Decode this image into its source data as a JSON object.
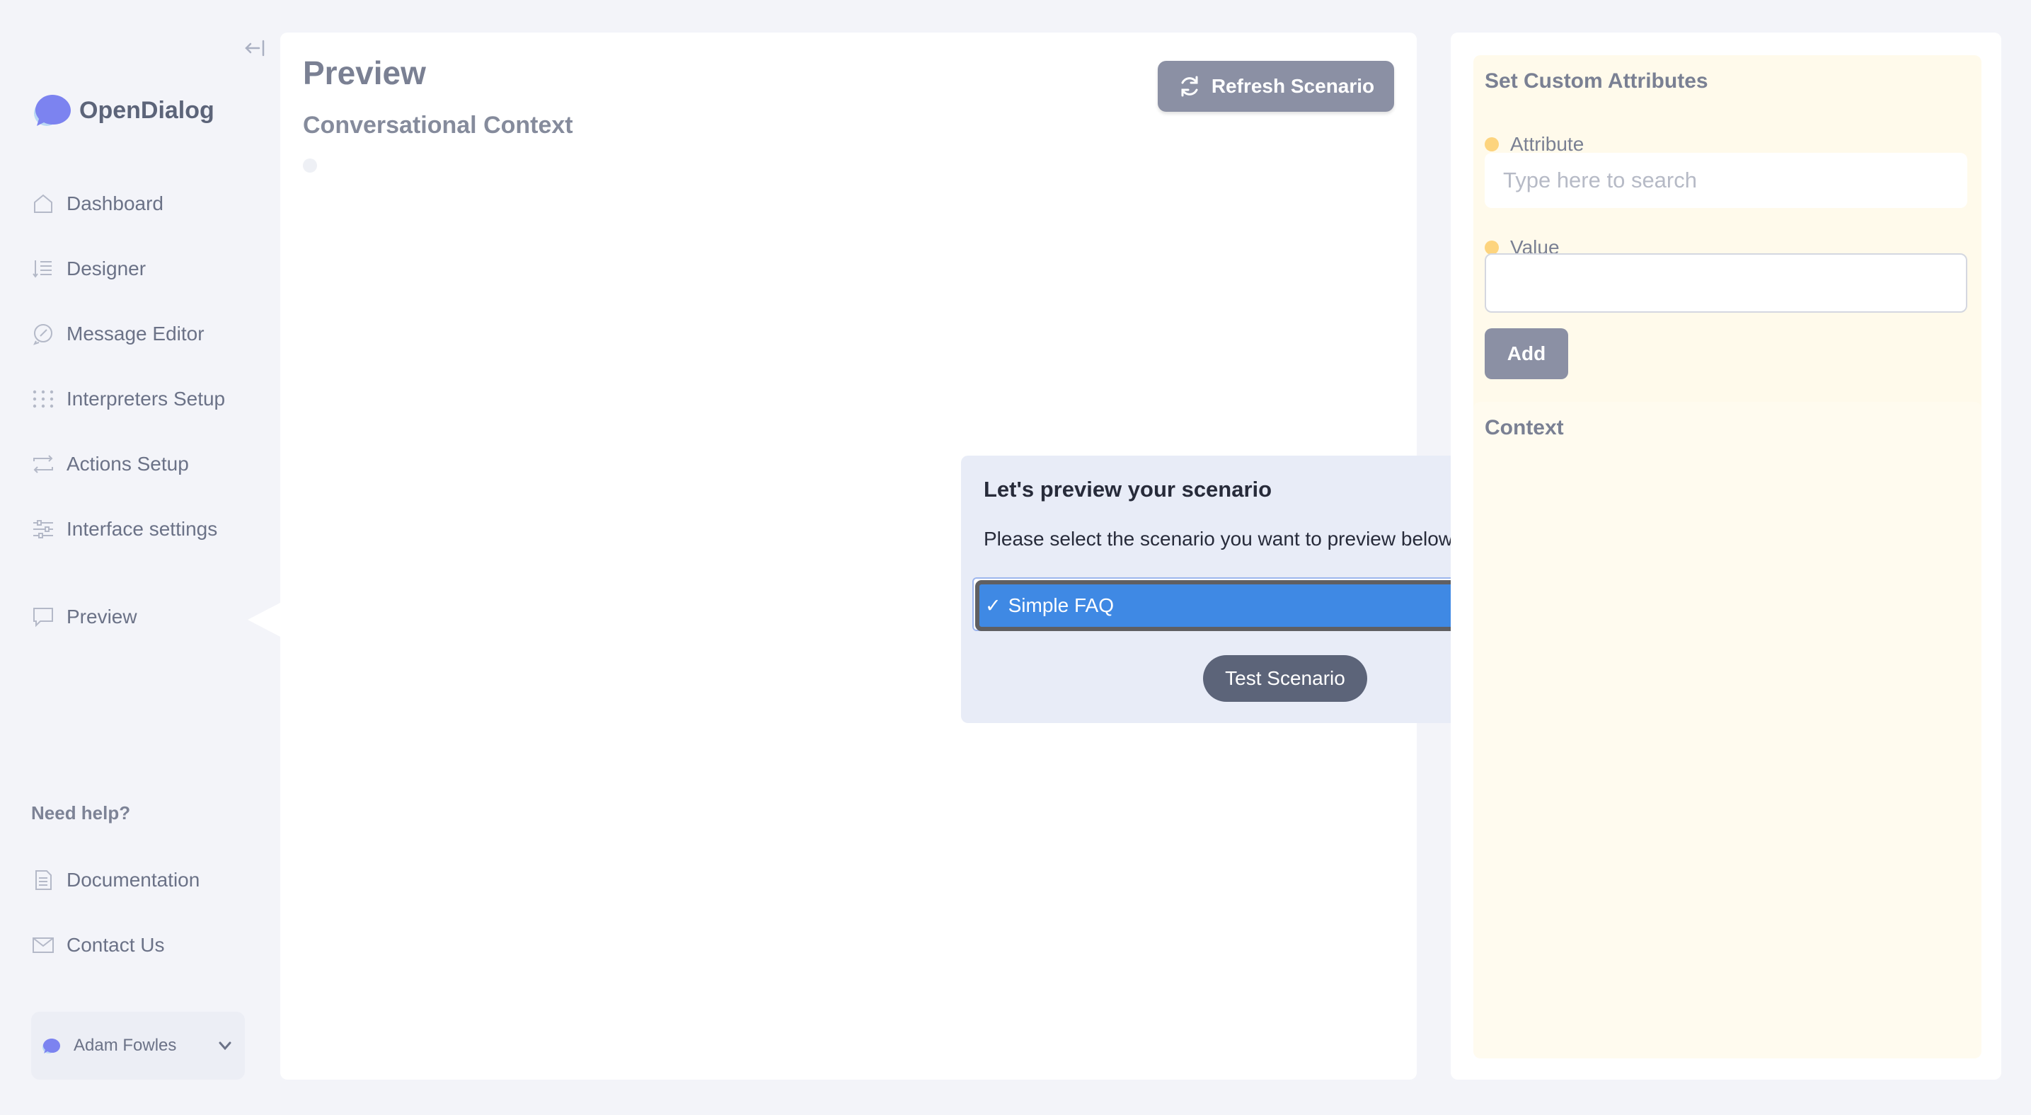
{
  "app": {
    "name": "OpenDialog"
  },
  "sidebar": {
    "items": [
      {
        "label": "Dashboard",
        "icon": "home-icon"
      },
      {
        "label": "Designer",
        "icon": "designer-icon"
      },
      {
        "label": "Message Editor",
        "icon": "message-editor-icon"
      },
      {
        "label": "Interpreters Setup",
        "icon": "interpreters-icon"
      },
      {
        "label": "Actions Setup",
        "icon": "actions-icon"
      },
      {
        "label": "Interface settings",
        "icon": "sliders-icon"
      },
      {
        "label": "Preview",
        "icon": "preview-icon",
        "active": true
      }
    ],
    "help_title": "Need help?",
    "help_items": [
      {
        "label": "Documentation",
        "icon": "document-icon"
      },
      {
        "label": "Contact Us",
        "icon": "mail-icon"
      }
    ],
    "user": {
      "name": "Adam Fowles"
    }
  },
  "main": {
    "title": "Preview",
    "subtitle": "Conversational Context",
    "refresh_label": "Refresh Scenario"
  },
  "modal": {
    "title": "Let's preview your scenario",
    "text": "Please select the scenario you want to preview below:",
    "check": "✓",
    "selected_option": "Simple FAQ",
    "test_label": "Test Scenario"
  },
  "attributes": {
    "title": "Set Custom Attributes",
    "attribute_label": "Attribute",
    "attribute_placeholder": "Type here to search",
    "value_label": "Value",
    "value": "",
    "add_label": "Add",
    "context_title": "Context"
  },
  "colors": {
    "accent": "#8b90a4",
    "brand_purple": "#7c83f0",
    "selected_option": "#3f89e4",
    "attribute_dot": "#fdd47e",
    "attr_card_bg": "#fffaeb"
  }
}
